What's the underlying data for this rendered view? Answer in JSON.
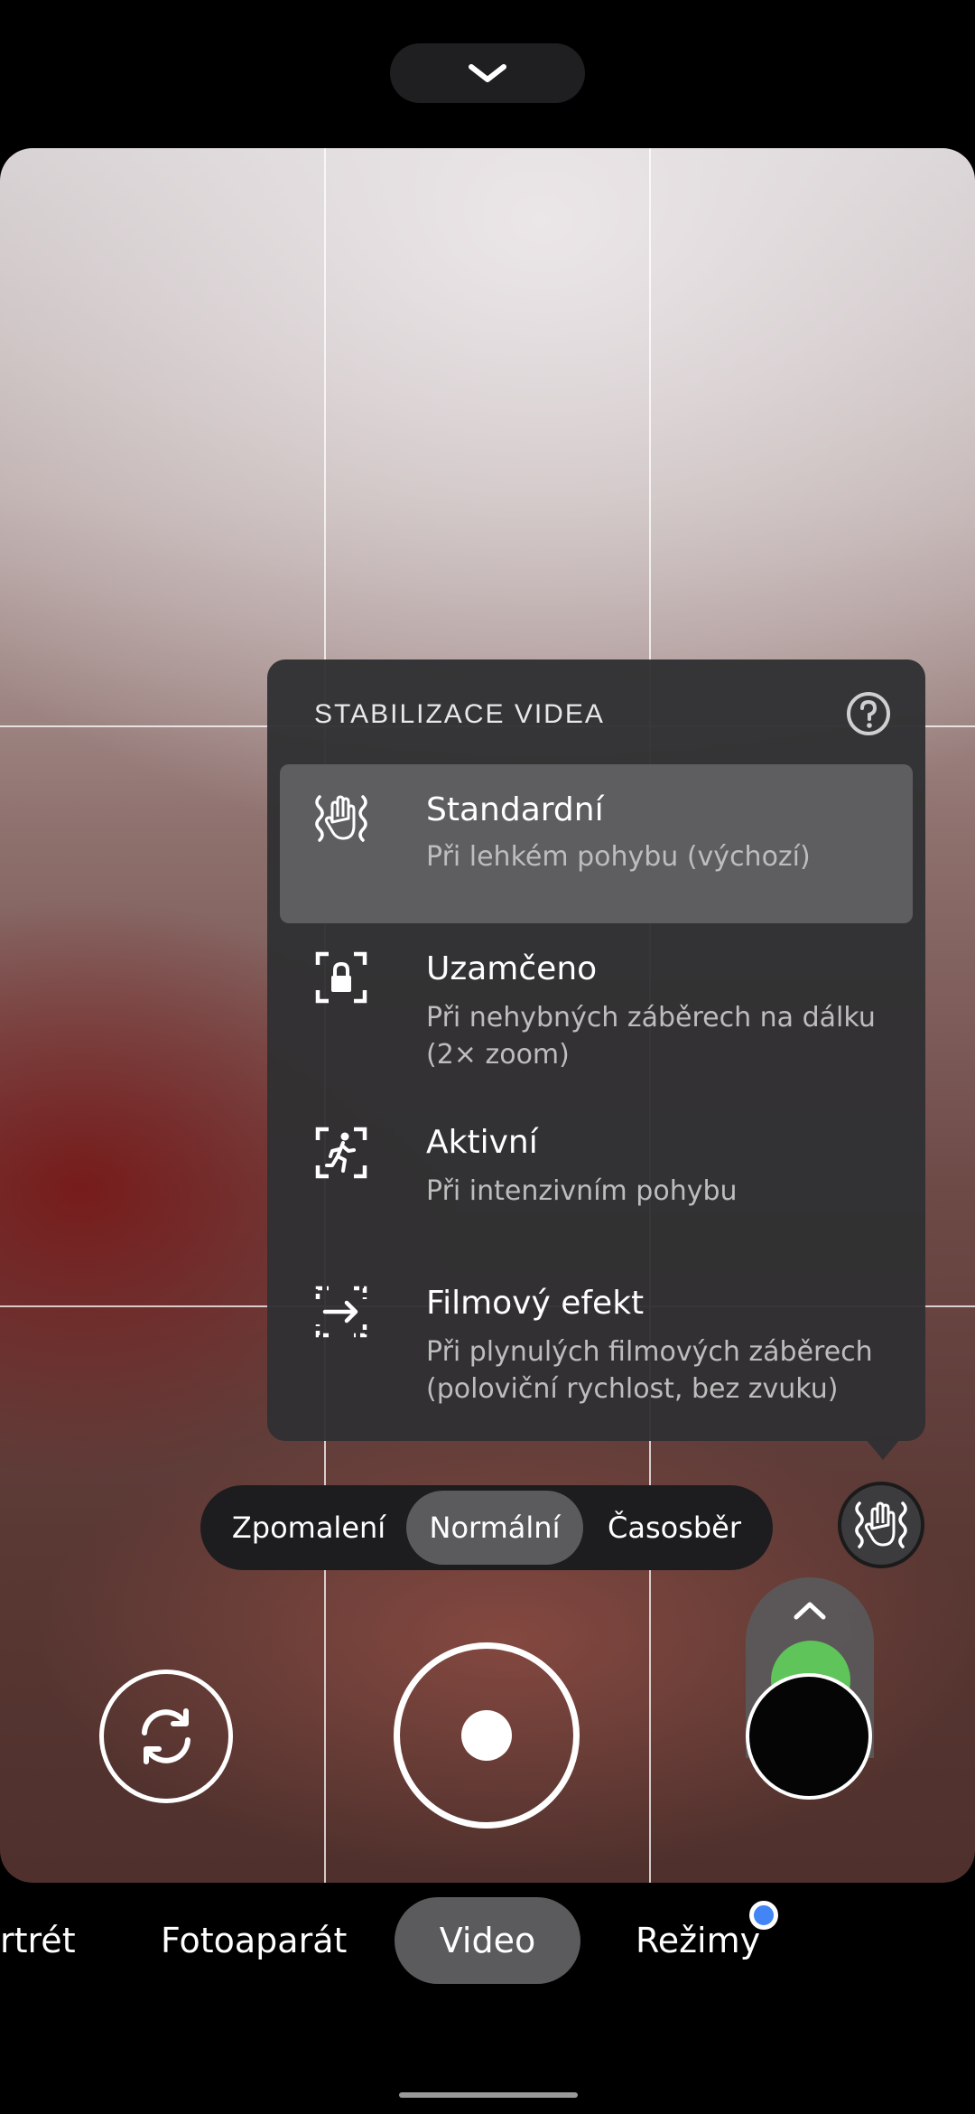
{
  "stabilization": {
    "title": "STABILIZACE VIDEA",
    "options": [
      {
        "icon": "stabilization-standard-icon",
        "title": "Standardní",
        "subtitle": "Při lehkém pohybu (výchozí)",
        "selected": true
      },
      {
        "icon": "lock-focus-icon",
        "title": "Uzamčeno",
        "subtitle": "Při nehybných záběrech na dálku (2× zoom)",
        "selected": false
      },
      {
        "icon": "active-runner-icon",
        "title": "Aktivní",
        "subtitle": "Při intenzivním pohybu",
        "selected": false
      },
      {
        "icon": "cinematic-pan-icon",
        "title": "Filmový efekt",
        "subtitle": "Při plynulých filmových záběrech (poloviční rychlost, bez zvuku)",
        "selected": false
      }
    ]
  },
  "speed": {
    "items": [
      "Zpomalení",
      "Normální",
      "Časosběr"
    ],
    "selected": "Normální"
  },
  "modes": {
    "items": [
      "rtrét",
      "Fotoaparát",
      "Video",
      "Režimy"
    ],
    "selected": "Video"
  },
  "colors": {
    "accent_dot": "#4285f4",
    "panel_bg": "#303032",
    "selected_option_bg": "#5e5e60"
  }
}
